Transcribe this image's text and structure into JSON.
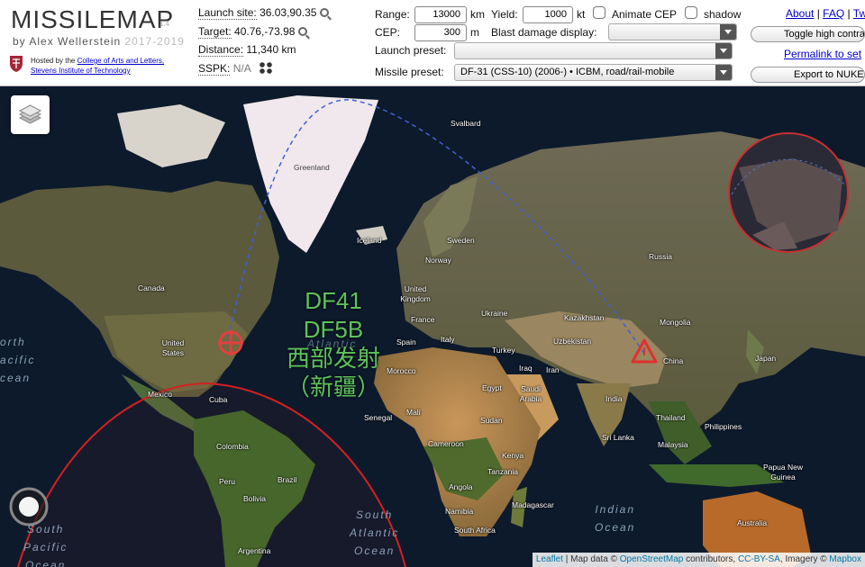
{
  "header": {
    "app_title": "MISSILEMAP",
    "version": "1.4",
    "byline": "by Alex Wellerstein",
    "years": "2017-2019",
    "hosted_prefix": "Hosted by the",
    "hosted_link_1": "College of Arts and Letters,",
    "hosted_link_2": "Stevens Institute of Technology"
  },
  "info": {
    "launch_site_label": "Launch site:",
    "launch_site_value": "36.03,90.35",
    "target_label": "Target:",
    "target_value": "40.76,-73.98",
    "distance_label": "Distance:",
    "distance_value": "11,340 km",
    "sspk_label": "SSPK:",
    "sspk_value": "N/A"
  },
  "controls": {
    "range_label": "Range:",
    "range_value": "13000",
    "range_unit": "km",
    "yield_label": "Yield:",
    "yield_value": "1000",
    "yield_unit": "kt",
    "animate_cep_label": "Animate CEP",
    "shadow_label": "shadow",
    "cep_label": "CEP:",
    "cep_value": "300",
    "cep_unit": "m",
    "blast_label": "Blast damage display:",
    "blast_value": "",
    "launch_preset_label": "Launch preset:",
    "launch_preset_value": "",
    "missile_preset_label": "Missile preset:",
    "missile_preset_value": "DF-31 (CSS-10) (2006-) • ICBM, road/rail-mobile"
  },
  "right_links": {
    "about": "About",
    "sep1": "|",
    "faq": "FAQ",
    "sep2": "|",
    "tw": "Tw",
    "high_contrast": "Toggle high contrast",
    "permalink": "Permalink to set",
    "export": "Export to NUKEMAP"
  },
  "map": {
    "annotation": [
      "DF41",
      "DF5B",
      "西部发射",
      "（新疆）"
    ],
    "places": {
      "svalbard": "Svalbard",
      "greenland": "Greenland",
      "iceland": "Iceland",
      "sweden": "Sweden",
      "norway": "Norway",
      "russia": "Russia",
      "canada": "Canada",
      "uk": "United Kingdom",
      "france": "France",
      "ukraine": "Ukraine",
      "kazakhstan": "Kazakhstan",
      "mongolia": "Mongolia",
      "spain": "Spain",
      "italy": "Italy",
      "turkey": "Turkey",
      "uzbekistan": "Uzbekistan",
      "us": "United States",
      "iraq": "Iraq",
      "iran": "Iran",
      "china": "China",
      "japan": "Japan",
      "morocco": "Morocco",
      "egypt": "Egypt",
      "saudi": "Saudi Arabia",
      "mexico": "Mexico",
      "cuba": "Cuba",
      "india": "India",
      "senegal": "Senegal",
      "mali": "Mali",
      "sudan": "Sudan",
      "thailand": "Thailand",
      "philippines": "Philippines",
      "colombia": "Colombia",
      "cameroon": "Cameroon",
      "srilanka": "Sri Lanka",
      "malaysia": "Malaysia",
      "kenya": "Kenya",
      "peru": "Peru",
      "brazil": "Brazil",
      "tanzania": "Tanzania",
      "png": "Papua New Guinea",
      "bolivia": "Bolivia",
      "angola": "Angola",
      "madagascar": "Madagascar",
      "namibia": "Namibia",
      "australia": "Australia",
      "southafrica": "South Africa",
      "argentina": "Argentina"
    },
    "oceans": {
      "north_pacific": [
        "orth",
        "acific",
        "cean"
      ],
      "atlantic_top": "Atlantic",
      "south_pacific": [
        "South",
        "Pacific",
        "Ocean"
      ],
      "south_atlantic": [
        "South",
        "Atlantic",
        "Ocean"
      ],
      "indian": [
        "Indian",
        "Ocean"
      ]
    },
    "attribution": {
      "leaflet": "Leaflet",
      "mapdata": " | Map data © ",
      "osm": "OpenStreetMap",
      "contrib": " contributors, ",
      "ccbysa": "CC-BY-SA",
      "imagery": ", Imagery © ",
      "mapbox": "Mapbox"
    }
  },
  "colors": {
    "link": "#0000cc",
    "annotation_green": "#5ec25a",
    "range_circle": "#d42020",
    "trajectory": "#4060d0"
  }
}
